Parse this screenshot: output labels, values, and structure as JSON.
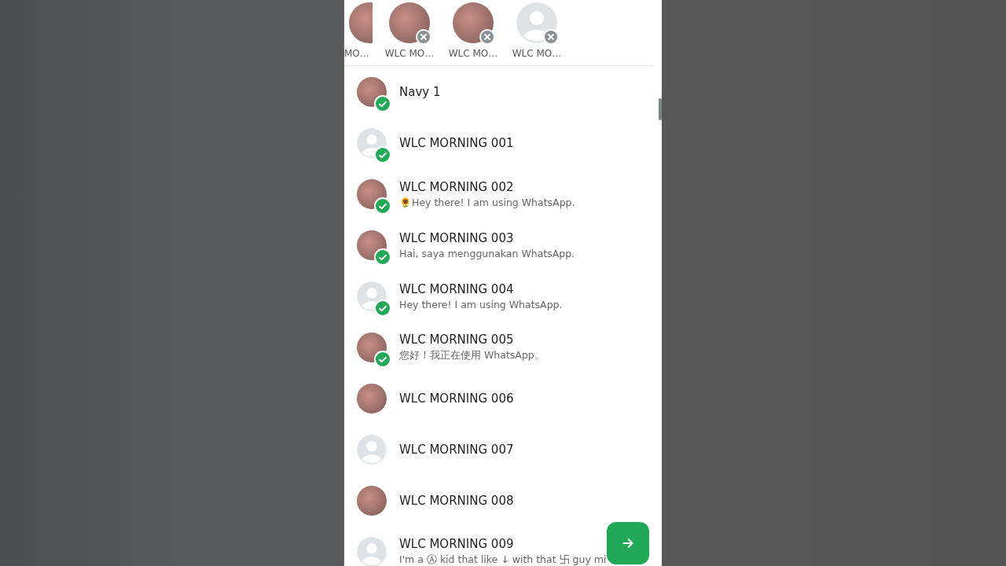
{
  "selected_contacts": [
    {
      "label": "MO…",
      "kind": "photo"
    },
    {
      "label": "WLC MO…",
      "kind": "photo"
    },
    {
      "label": "WLC MO…",
      "kind": "photo"
    },
    {
      "label": "WLC MO…",
      "kind": "default"
    }
  ],
  "contacts": [
    {
      "name": "Navy 1",
      "kind": "photo",
      "selected": true
    },
    {
      "name": "WLC MORNING 001",
      "kind": "default",
      "selected": true
    },
    {
      "name": "WLC MORNING 002",
      "status": "🌻Hey there! I am using WhatsApp.",
      "kind": "photo",
      "selected": true
    },
    {
      "name": "WLC MORNING 003",
      "status": "Hai, saya menggunakan WhatsApp.",
      "kind": "photo",
      "selected": true
    },
    {
      "name": "WLC MORNING 004",
      "status": "Hey there! I am using WhatsApp.",
      "kind": "default",
      "selected": true
    },
    {
      "name": "WLC MORNING 005",
      "status": "您好！我正在使用 WhatsApp。",
      "kind": "photo",
      "selected": true
    },
    {
      "name": "WLC MORNING 006",
      "kind": "photo",
      "selected": false
    },
    {
      "name": "WLC MORNING 007",
      "kind": "default",
      "selected": false
    },
    {
      "name": "WLC MORNING 008",
      "kind": "photo",
      "selected": false
    },
    {
      "name": "WLC MORNING 009",
      "status": "I'm a Ⓐ kid that like ↓ with that 卐 guy mi",
      "kind": "default",
      "selected": false
    }
  ]
}
